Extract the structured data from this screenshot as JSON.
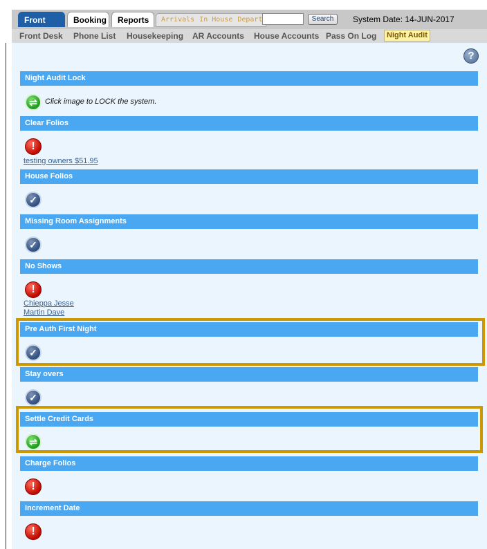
{
  "topbar": {
    "tabs": [
      {
        "label": "Front Desk"
      },
      {
        "label": "Booking"
      },
      {
        "label": "Reports"
      }
    ],
    "quicklinks": [
      "Arrivals",
      "In House",
      "Departures"
    ],
    "search_value": "",
    "search_button": "Search",
    "system_date": "System Date: 14-JUN-2017"
  },
  "subnav": {
    "items": [
      "Front Desk",
      "Phone List",
      "Housekeeping",
      "AR Accounts",
      "House Accounts",
      "Pass On Log",
      "Night Audit"
    ],
    "active": "Night Audit"
  },
  "help": {
    "icon": "help-icon",
    "glyph": "?"
  },
  "audit": {
    "sections": [
      {
        "title": "Night Audit Lock",
        "status": "action",
        "message": "Click image to LOCK the system."
      },
      {
        "title": "Clear Folios",
        "status": "error",
        "links": [
          "testing owners $51.95"
        ]
      },
      {
        "title": "House Folios",
        "status": "ok"
      },
      {
        "title": "Missing Room Assignments",
        "status": "ok"
      },
      {
        "title": "No Shows",
        "status": "error",
        "links": [
          "Chieppa Jesse",
          "Martin Dave"
        ]
      },
      {
        "title": "Pre Auth First Night",
        "status": "ok"
      },
      {
        "title": "Stay overs",
        "status": "ok"
      },
      {
        "title": "Settle Credit Cards",
        "status": "action"
      },
      {
        "title": "Charge Folios",
        "status": "error"
      },
      {
        "title": "Increment Date",
        "status": "error"
      }
    ]
  },
  "colors": {
    "section_header": "#4aa8f2",
    "content_bg": "#eaf5fd",
    "highlight": "#cc9900",
    "active_tab": "#1f5fa8"
  }
}
